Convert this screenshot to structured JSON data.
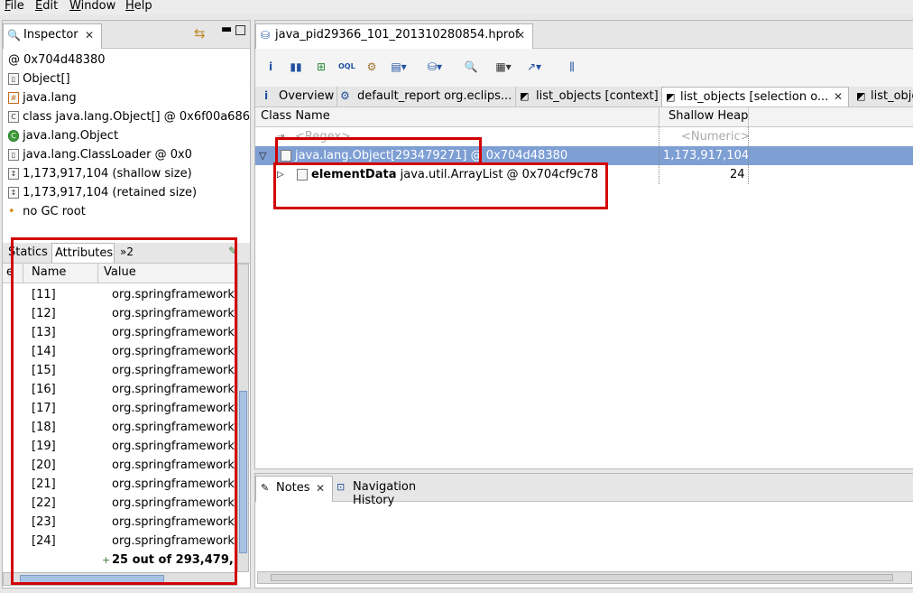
{
  "menu": {
    "file": "File",
    "edit": "Edit",
    "window": "Window",
    "help": "Help"
  },
  "inspector": {
    "tab": "Inspector",
    "close": "✕",
    "info": [
      {
        "icon": "at-icon",
        "glyph": "@",
        "text": "0x704d48380"
      },
      {
        "icon": "array-icon",
        "glyph": "▯",
        "text": "Object[]"
      },
      {
        "icon": "package-icon",
        "glyph": "#",
        "text": "java.lang"
      },
      {
        "icon": "class-icon",
        "glyph": "C",
        "text": "class java.lang.Object[] @ 0x6f00a686"
      },
      {
        "icon": "superclass-icon",
        "glyph": "C",
        "text": "java.lang.Object"
      },
      {
        "icon": "classloader-icon",
        "glyph": "▯",
        "text": "java.lang.ClassLoader @ 0x0"
      },
      {
        "icon": "shallow-size-icon",
        "glyph": "↕",
        "text": "1,173,917,104 (shallow size)"
      },
      {
        "icon": "retained-size-icon",
        "glyph": "↕",
        "text": "1,173,917,104 (retained size)"
      },
      {
        "icon": "gc-root-icon",
        "glyph": "•",
        "text": "no GC root"
      }
    ],
    "subtabs": {
      "statics": "Statics",
      "attributes": "Attributes",
      "more": "»2"
    },
    "columns": {
      "type": "e",
      "name": "Name",
      "value": "Value"
    },
    "rows": [
      {
        "name": "[11]",
        "value": "org.springframework"
      },
      {
        "name": "[12]",
        "value": "org.springframework"
      },
      {
        "name": "[13]",
        "value": "org.springframework"
      },
      {
        "name": "[14]",
        "value": "org.springframework"
      },
      {
        "name": "[15]",
        "value": "org.springframework"
      },
      {
        "name": "[16]",
        "value": "org.springframework"
      },
      {
        "name": "[17]",
        "value": "org.springframework"
      },
      {
        "name": "[18]",
        "value": "org.springframework"
      },
      {
        "name": "[19]",
        "value": "org.springframework"
      },
      {
        "name": "[20]",
        "value": "org.springframework"
      },
      {
        "name": "[21]",
        "value": "org.springframework"
      },
      {
        "name": "[22]",
        "value": "org.springframework"
      },
      {
        "name": "[23]",
        "value": "org.springframework"
      },
      {
        "name": "[24]",
        "value": "org.springframework"
      }
    ],
    "summary": "25 out of 293,479,"
  },
  "editor": {
    "tab": "java_pid29366_101_201310280854.hprof",
    "close": "✕",
    "subtabs": [
      {
        "label": "Overview",
        "icon": "info-icon"
      },
      {
        "label": "default_report  org.eclips...",
        "icon": "report-icon"
      },
      {
        "label": "list_objects [context]",
        "icon": "query-icon"
      },
      {
        "label": "list_objects [selection o...",
        "icon": "query-icon",
        "active": true
      },
      {
        "label": "list_obje",
        "icon": "query-icon"
      }
    ],
    "columns": {
      "class_name": "Class Name",
      "shallow": "Shallow Heap"
    },
    "regex": "<Regex>",
    "numeric": "<Numeric>",
    "selected_row": {
      "label": "java.lang.Object[293479271] @ 0x704d48380",
      "shallow": "1,173,917,104"
    },
    "child_row": {
      "bold": "elementData",
      "label": " java.util.ArrayList @ 0x704cf9c78",
      "shallow": "24"
    }
  },
  "bottom": {
    "notes_tab": "Notes",
    "nav_tab": "Navigation History",
    "close": "✕"
  },
  "colors": {
    "selection": "#7e9fd4",
    "highlight": "#d20000",
    "bg": "#e8e8e8"
  }
}
